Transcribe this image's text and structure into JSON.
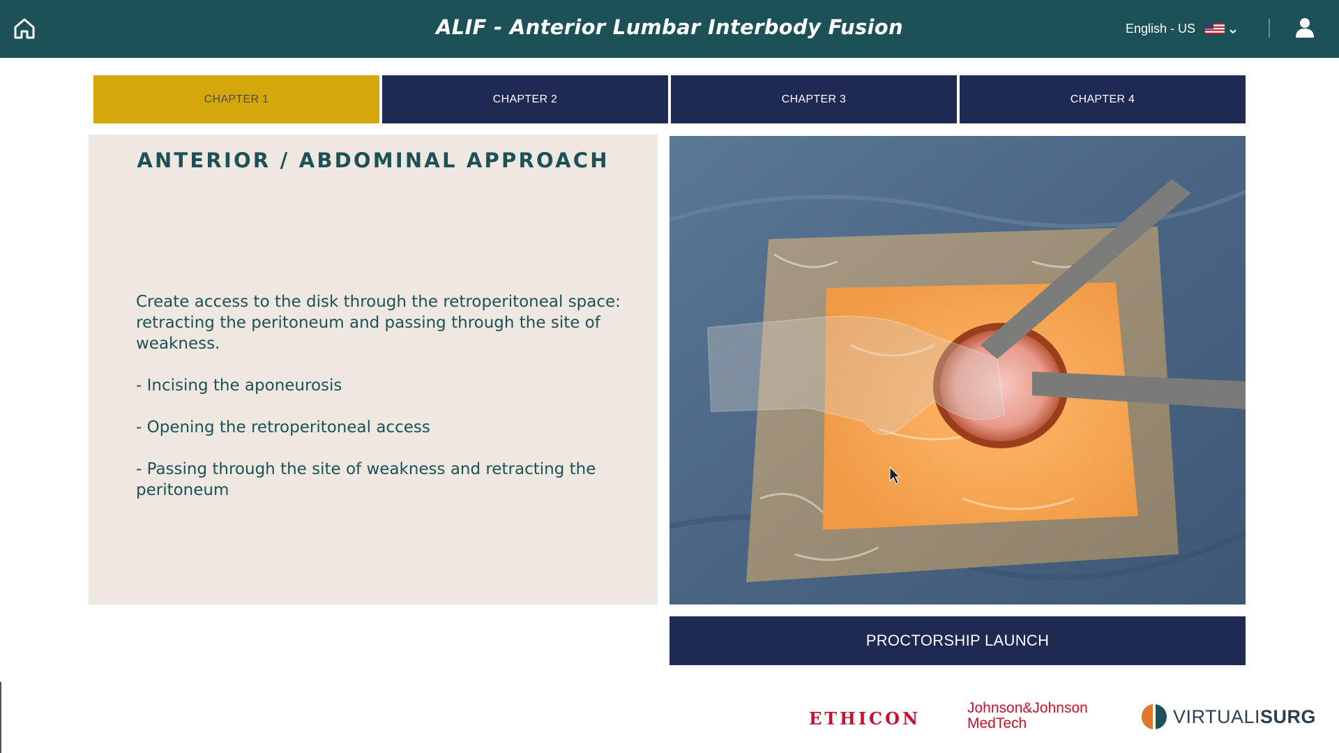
{
  "header": {
    "title": "ALIF - Anterior Lumbar Interbody Fusion",
    "language": "English - US"
  },
  "tabs": [
    {
      "label": "CHAPTER 1",
      "active": true
    },
    {
      "label": "CHAPTER 2",
      "active": false
    },
    {
      "label": "CHAPTER 3",
      "active": false
    },
    {
      "label": "CHAPTER 4",
      "active": false
    }
  ],
  "content": {
    "title": "ANTERIOR / ABDOMINAL APPROACH",
    "paragraphs": [
      "Create access to the disk through the retroperitoneal space: retracting the peritoneum and passing through the site of weakness.",
      "- Incising the aponeurosis",
      "- Opening the retroperitoneal access",
      "- Passing through the site of weakness and retracting the peritoneum"
    ]
  },
  "launch_button": "PROCTORSHIP LAUNCH",
  "footer": {
    "logo_ethicon": "ETHICON",
    "logo_jnj_line1": "Johnson&Johnson",
    "logo_jnj_line2": "MedTech",
    "logo_virtualisurg_light": "VIRTUALI",
    "logo_virtualisurg_bold": "SURG"
  },
  "colors": {
    "header_bg": "#1b5157",
    "tab_active": "#d4a80a",
    "tab_inactive": "#1e2a52",
    "panel_bg": "#efe8e0",
    "accent_text": "#1b5157",
    "brand_red": "#c8102e"
  },
  "icons": {
    "home": "home-icon",
    "user": "user-icon",
    "flag": "us-flag-icon",
    "dropdown": "chevron-down-icon"
  }
}
